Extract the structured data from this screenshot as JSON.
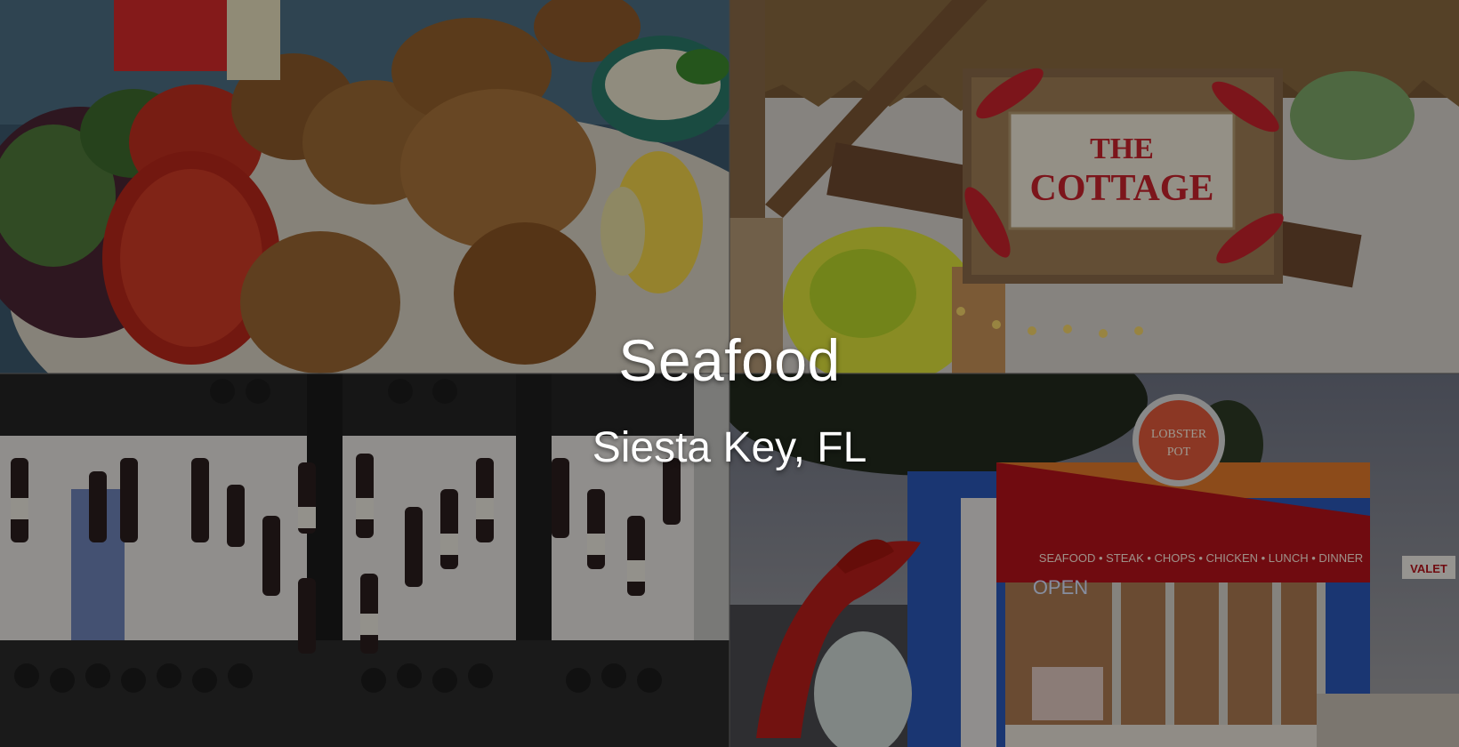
{
  "hero": {
    "title": "Seafood",
    "subtitle": "Siesta Key, FL"
  },
  "photos": {
    "cottage_sign": {
      "line1": "THE",
      "line2": "COTTAGE"
    },
    "lobster_pot": {
      "sign_line1": "LOBSTER",
      "sign_line2": "POT",
      "awning_text": "SEAFOOD • STEAK • CHOPS • CHICKEN • LUNCH • DINNER",
      "open_sign": "OPEN",
      "valet_sign": "VALET"
    }
  },
  "colors": {
    "overlay": "#000000",
    "title_text": "#ffffff",
    "sign_red": "#c8232c",
    "awning_red": "#b5121b",
    "building_blue": "#2a58b8"
  }
}
